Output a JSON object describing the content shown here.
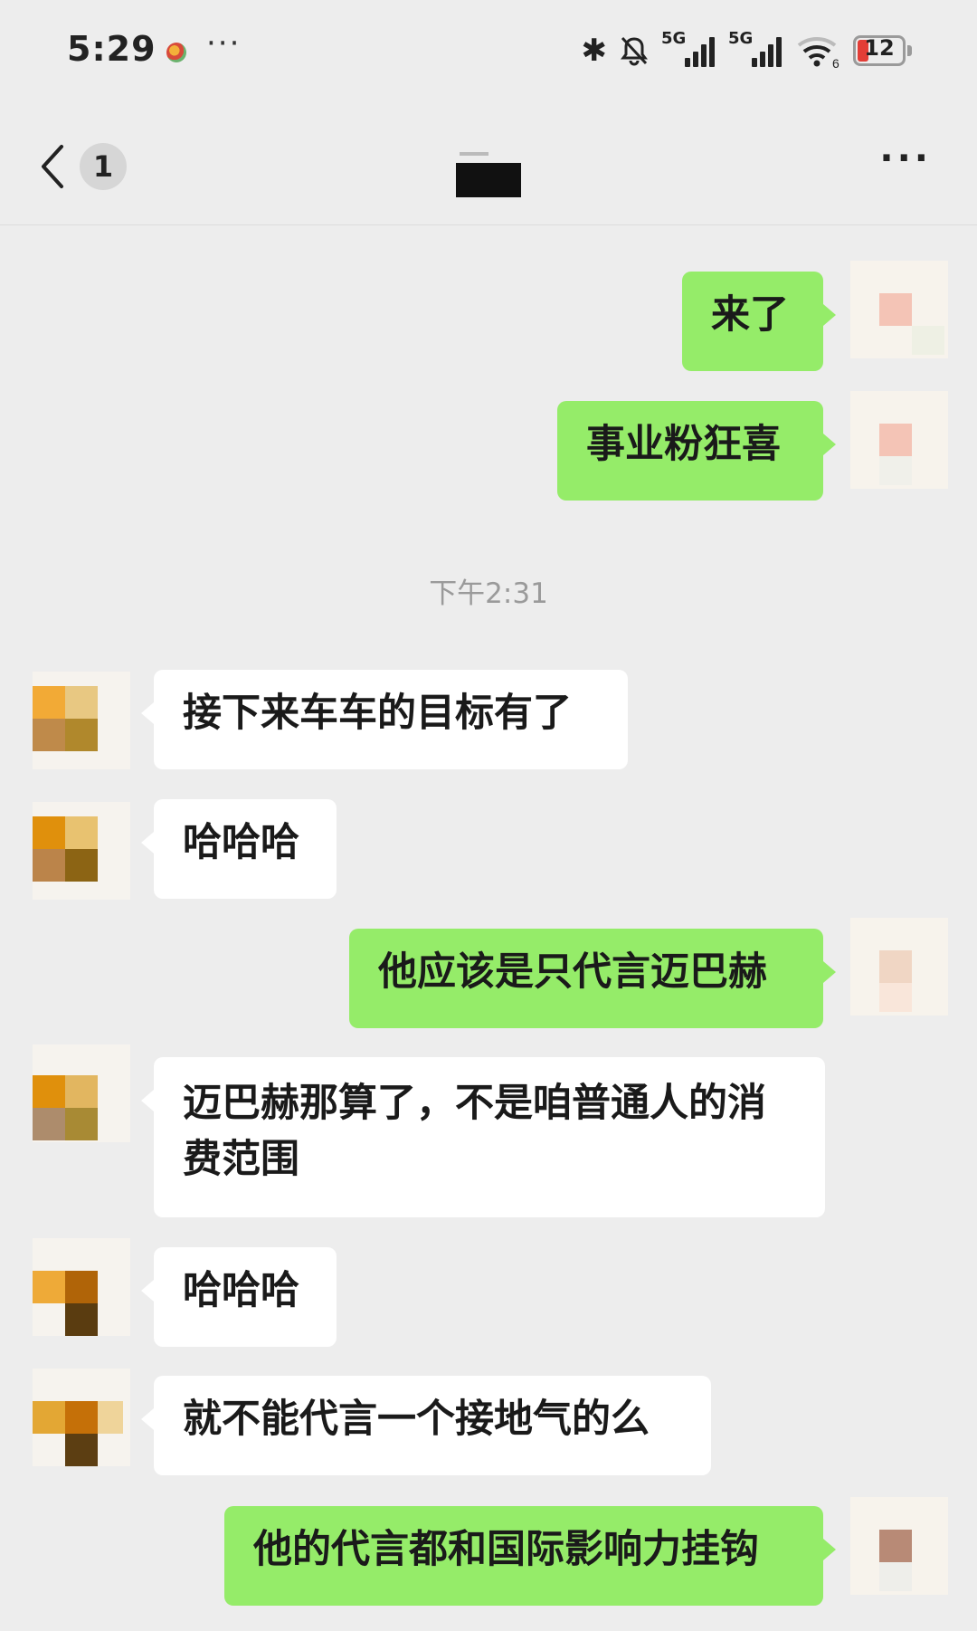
{
  "status_bar": {
    "time": "5:29",
    "more": "···",
    "signal1": "5G",
    "signal2": "5G",
    "wifi_sub": "6",
    "battery": "12",
    "battery_color": "#e33d36"
  },
  "nav": {
    "unread_count": "1",
    "more": "···"
  },
  "timestamp": "下午2:31",
  "colors": {
    "sent_bubble": "#95ec69",
    "recv_bubble": "#ffffff",
    "background": "#ededed"
  },
  "messages": [
    {
      "direction": "sent",
      "text": "来了"
    },
    {
      "direction": "sent",
      "text": "事业粉狂喜"
    },
    {
      "direction": "recv",
      "text": "接下来车车的目标有了"
    },
    {
      "direction": "recv",
      "text": "哈哈哈"
    },
    {
      "direction": "sent",
      "text": "他应该是只代言迈巴赫"
    },
    {
      "direction": "recv",
      "text": "迈巴赫那算了，不是咱普通人的消\n费范围"
    },
    {
      "direction": "recv",
      "text": "哈哈哈"
    },
    {
      "direction": "recv",
      "text": "就不能代言一个接地气的么"
    },
    {
      "direction": "sent",
      "text": "他的代言都和国际影响力挂钩"
    }
  ]
}
